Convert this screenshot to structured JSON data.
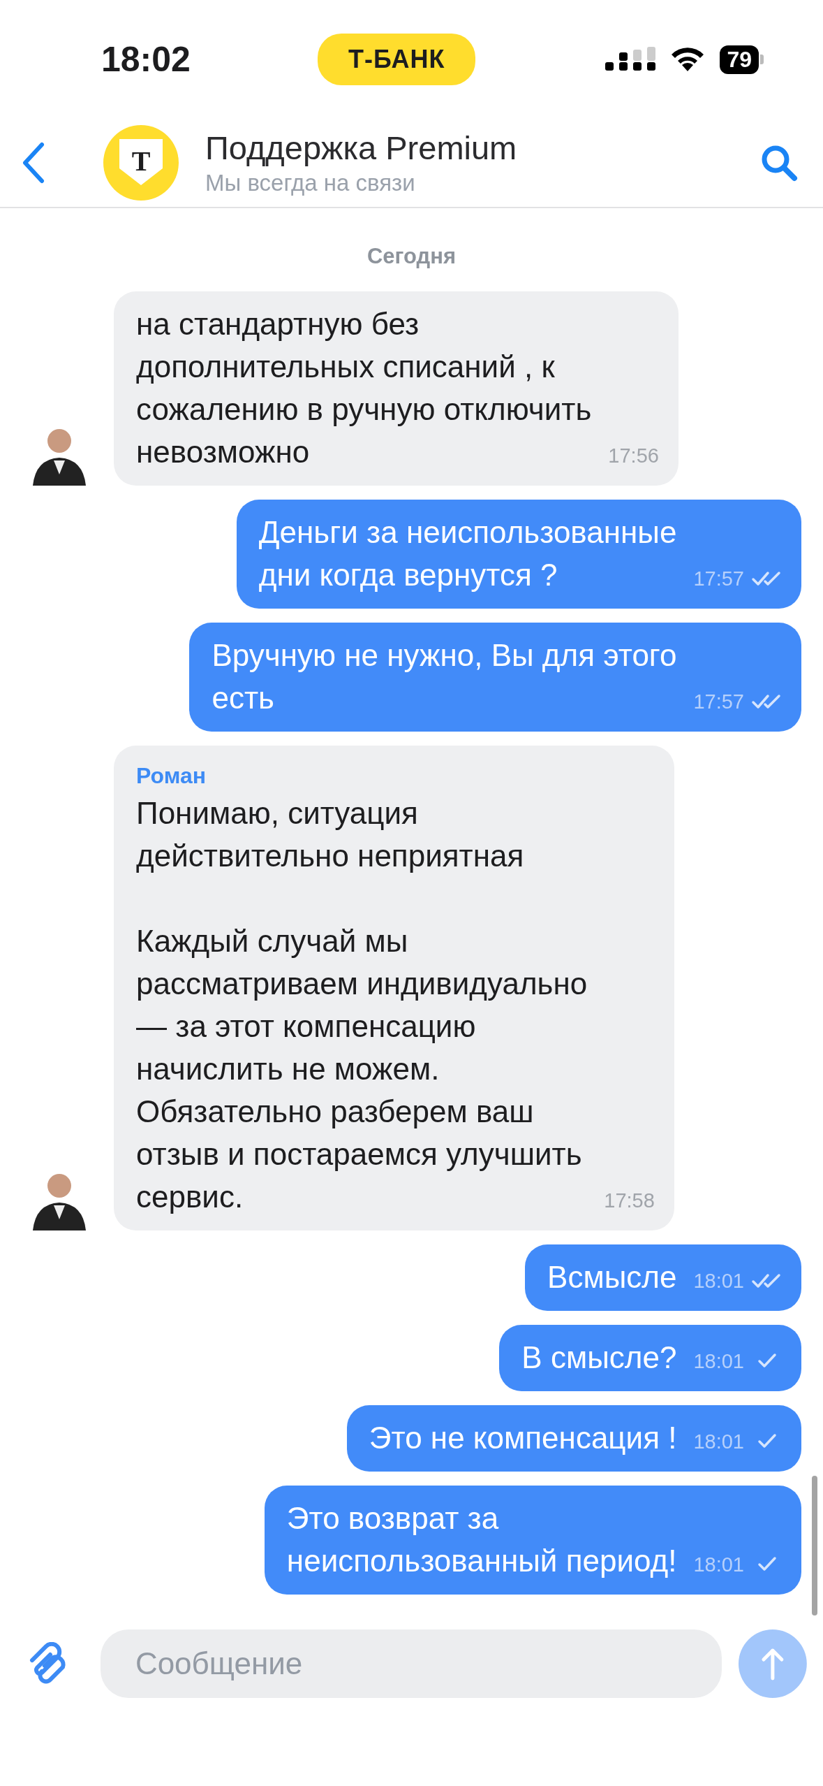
{
  "status_bar": {
    "time": "18:02",
    "carrier_pill": "Т-БАНК",
    "battery": "79"
  },
  "header": {
    "logo_letter": "Т",
    "title": "Поддержка Premium",
    "subtitle": "Мы всегда на связи"
  },
  "date_chip": "Сегодня",
  "messages": [
    {
      "kind": "incoming",
      "text": "на стандартную без\nдополнительных списаний , к\nсожалению в ручную отключить\nневозможно",
      "time": "17:56"
    },
    {
      "kind": "outgoing",
      "text": "Деньги за неиспользованные\nдни когда вернутся ?",
      "time": "17:57",
      "read": true
    },
    {
      "kind": "outgoing",
      "text": "Вручную не нужно, Вы для этого\nесть",
      "time": "17:57",
      "read": true
    },
    {
      "kind": "incoming",
      "sender": "Роман",
      "text": "Понимаю, ситуация\nдействительно неприятная\n\nКаждый случай мы\nрассматриваем индивидуально\n— за этот компенсацию\nначислить не можем.\nОбязательно разберем ваш\nотзыв и постараемся улучшить\nсервис.",
      "time": "17:58"
    },
    {
      "kind": "outgoing",
      "text": "Всмысле",
      "time": "18:01",
      "read": true
    },
    {
      "kind": "outgoing",
      "text": "В смысле?",
      "time": "18:01",
      "read": false
    },
    {
      "kind": "outgoing",
      "text": "Это не компенсация !",
      "time": "18:01",
      "read": false
    },
    {
      "kind": "outgoing",
      "text": "Это возврат за\nнеиспользованный период!",
      "time": "18:01",
      "read": false
    }
  ],
  "composer": {
    "placeholder": "Сообщение"
  }
}
